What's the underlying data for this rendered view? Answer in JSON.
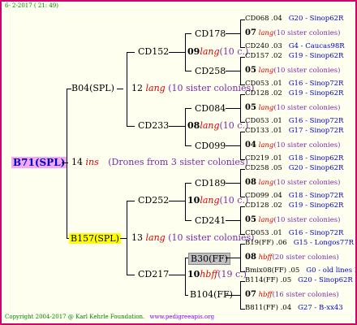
{
  "header": {
    "date": "6- 2-2017 ( 21: 49)"
  },
  "footer": {
    "copyright": "Copyright 2004-2017 @ Karl Kehrle Foundation.",
    "url": "www.pedigreeapis.org"
  },
  "root": {
    "name": "B71(SPL)",
    "year": "14",
    "line": "ins",
    "desc": "(Drones from 3 sister colonies)"
  },
  "gen1": [
    {
      "name": "B04(SPL)",
      "year": "12",
      "line": "lang",
      "desc": "(10 sister colonies)"
    },
    {
      "name": "B157(SPL)",
      "year": "13",
      "line": "lang",
      "desc": "(10 sister colonies)"
    }
  ],
  "gen2": [
    {
      "name": "CD152",
      "year": "09",
      "line": "lang",
      "desc": "(10 c.)"
    },
    {
      "name": "CD233",
      "year": "08",
      "line": "lang",
      "desc": "(10 c.)"
    },
    {
      "name": "CD252",
      "year": "10",
      "line": "lang",
      "desc": "(10 c.)"
    },
    {
      "name": "CD217",
      "year": "10",
      "line": "hbff",
      "desc": "(19 c.)"
    }
  ],
  "gen3": [
    "CD178",
    "CD258",
    "CD084",
    "CD099",
    "CD189",
    "CD241",
    "B30(FF)",
    "B104(FF)"
  ],
  "gen4": [
    {
      "a": "CD068 .04",
      "a2": "G20 - Sinop62R",
      "mid_year": "07",
      "mid_line": "lang",
      "mid_desc": "(10 sister colonies)",
      "b": "CD240 .03",
      "b2": "G4 - Caucas98R"
    },
    {
      "a": "CD157 .02",
      "a2": "G19 - Sinop62R",
      "mid_year": "05",
      "mid_line": "lang",
      "mid_desc": "(10 sister colonies)",
      "b": "CD053 .01",
      "b2": "G16 - Sinop72R"
    },
    {
      "a": "CD128 .02",
      "a2": "G19 - Sinop62R",
      "mid_year": "05",
      "mid_line": "lang",
      "mid_desc": "(10 sister colonies)",
      "b": "CD053 .01",
      "b2": "G16 - Sinop72R"
    },
    {
      "a": "CD133 .01",
      "a2": "G17 - Sinop72R",
      "mid_year": "04",
      "mid_line": "lang",
      "mid_desc": "(10 sister colonies)",
      "b": "CD219 .01",
      "b2": "G18 - Sinop62R"
    },
    {
      "a": "CD258 .05",
      "a2": "G20 - Sinop62R",
      "mid_year": "08",
      "mid_line": "lang",
      "mid_desc": "(10 sister colonies)",
      "b": "CD099 .04",
      "b2": "G18 - Sinop72R"
    },
    {
      "a": "CD128 .02",
      "a2": "G19 - Sinop62R",
      "mid_year": "05",
      "mid_line": "lang",
      "mid_desc": "(10 sister colonies)",
      "b": "CD053 .01",
      "b2": "G16 - Sinop72R"
    },
    {
      "a": "B19(FF) .06",
      "a2": "G15 - Longos77R",
      "mid_year": "08",
      "mid_line": "hbff",
      "mid_desc": "(20 sister colonies)",
      "b": "Bmix08(FF) .05",
      "b2": "G0 - old lines B"
    },
    {
      "a": "B114(FF) .05",
      "a2": "G20 - Sinop62R",
      "mid_year": "07",
      "mid_line": "hbff",
      "mid_desc": "(16 sister colonies)",
      "b": "B811(FF) .04",
      "b2": "G27 - B-xx43"
    }
  ]
}
